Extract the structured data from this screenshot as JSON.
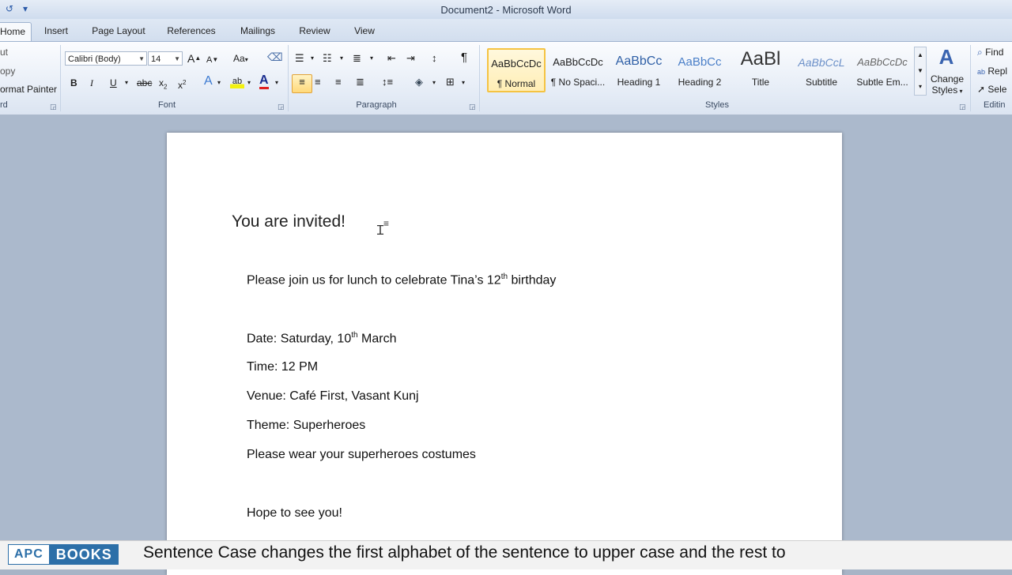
{
  "window": {
    "title": "Document2  -  Microsoft Word"
  },
  "tabs": [
    "Home",
    "Insert",
    "Page Layout",
    "References",
    "Mailings",
    "Review",
    "View"
  ],
  "clipboard": {
    "cut": "ut",
    "copy": "opy",
    "format_painter": "ormat Painter",
    "label": "rd"
  },
  "font": {
    "label": "Font",
    "family": "Calibri (Body)",
    "size": "14",
    "grow": "A",
    "shrink": "A",
    "change_case": "Aa",
    "bold": "B",
    "italic": "I",
    "underline": "U",
    "strike": "abc",
    "subscript": "x",
    "superscript": "x"
  },
  "paragraph": {
    "label": "Paragraph",
    "pilcrow": "¶"
  },
  "styles": {
    "label": "Styles",
    "items": [
      {
        "preview": "AaBbCcDc",
        "name": "¶ Normal"
      },
      {
        "preview": "AaBbCcDc",
        "name": "¶ No Spaci..."
      },
      {
        "preview": "AaBbCc",
        "name": "Heading 1"
      },
      {
        "preview": "AaBbCc",
        "name": "Heading 2"
      },
      {
        "preview": "AaBl",
        "name": "Title"
      },
      {
        "preview": "AaBbCcL",
        "name": "Subtitle"
      },
      {
        "preview": "AaBbCcDc",
        "name": "Subtle Em..."
      }
    ],
    "change_styles": [
      "Change",
      "Styles"
    ]
  },
  "editing": {
    "label": "Editin",
    "find": "Find",
    "replace": "Repl",
    "select": "Sele"
  },
  "document": {
    "heading": "You are invited!",
    "line1_pre": "Please join us for lunch to celebrate Tina’s 12",
    "line1_sup": "th",
    "line1_post": " birthday",
    "date_pre": "Date: Saturday,  10",
    "date_sup": "th",
    "date_post": " March",
    "time": "Time: 12 PM",
    "venue": "Venue:  Café First, Vasant Kunj",
    "theme": "Theme: Superheroes",
    "wear": "Please wear your superheroes  costumes",
    "hope": "Hope to see you!"
  },
  "caption": {
    "brand_a": "APC",
    "brand_b": "BOOKS",
    "text": "Sentence Case changes the first alphabet of the sentence to upper case and the rest to"
  },
  "colors": {
    "brand": "#2c6fa8",
    "selected_style": "#f5c342",
    "heading_blue": "#2f5fa6"
  }
}
